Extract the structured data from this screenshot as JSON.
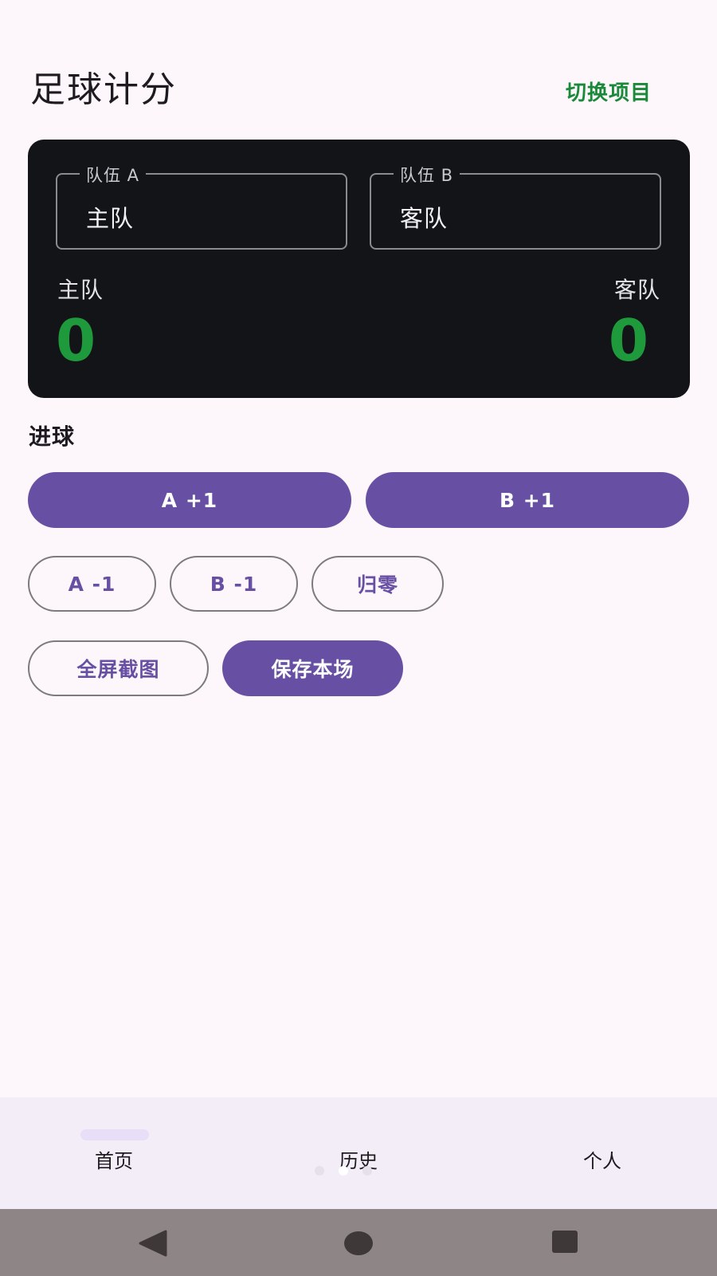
{
  "header": {
    "title": "足球计分",
    "switch_label": "切换项目"
  },
  "scoreboard": {
    "team_a": {
      "field_label": "队伍 A",
      "field_value": "主队",
      "name": "主队",
      "score": "0"
    },
    "team_b": {
      "field_label": "队伍 B",
      "field_value": "客队",
      "name": "客队",
      "score": "0"
    }
  },
  "goals": {
    "section_label": "进球",
    "a_plus": "A +1",
    "b_plus": "B +1",
    "a_minus": "A -1",
    "b_minus": "B -1",
    "reset": "归零"
  },
  "actions": {
    "screenshot": "全屏截图",
    "save": "保存本场"
  },
  "bottom_nav": {
    "items": [
      {
        "label": "首页",
        "selected": true
      },
      {
        "label": "历史",
        "selected": false
      },
      {
        "label": "个人",
        "selected": false
      }
    ]
  },
  "colors": {
    "accent": "#6750a4",
    "score": "#1e9a3c",
    "switch_link": "#1a8a3a",
    "card": "#121417",
    "background": "#fdf7fc"
  },
  "system_nav": {
    "icons": [
      "back-icon",
      "home-icon",
      "recents-icon"
    ]
  }
}
